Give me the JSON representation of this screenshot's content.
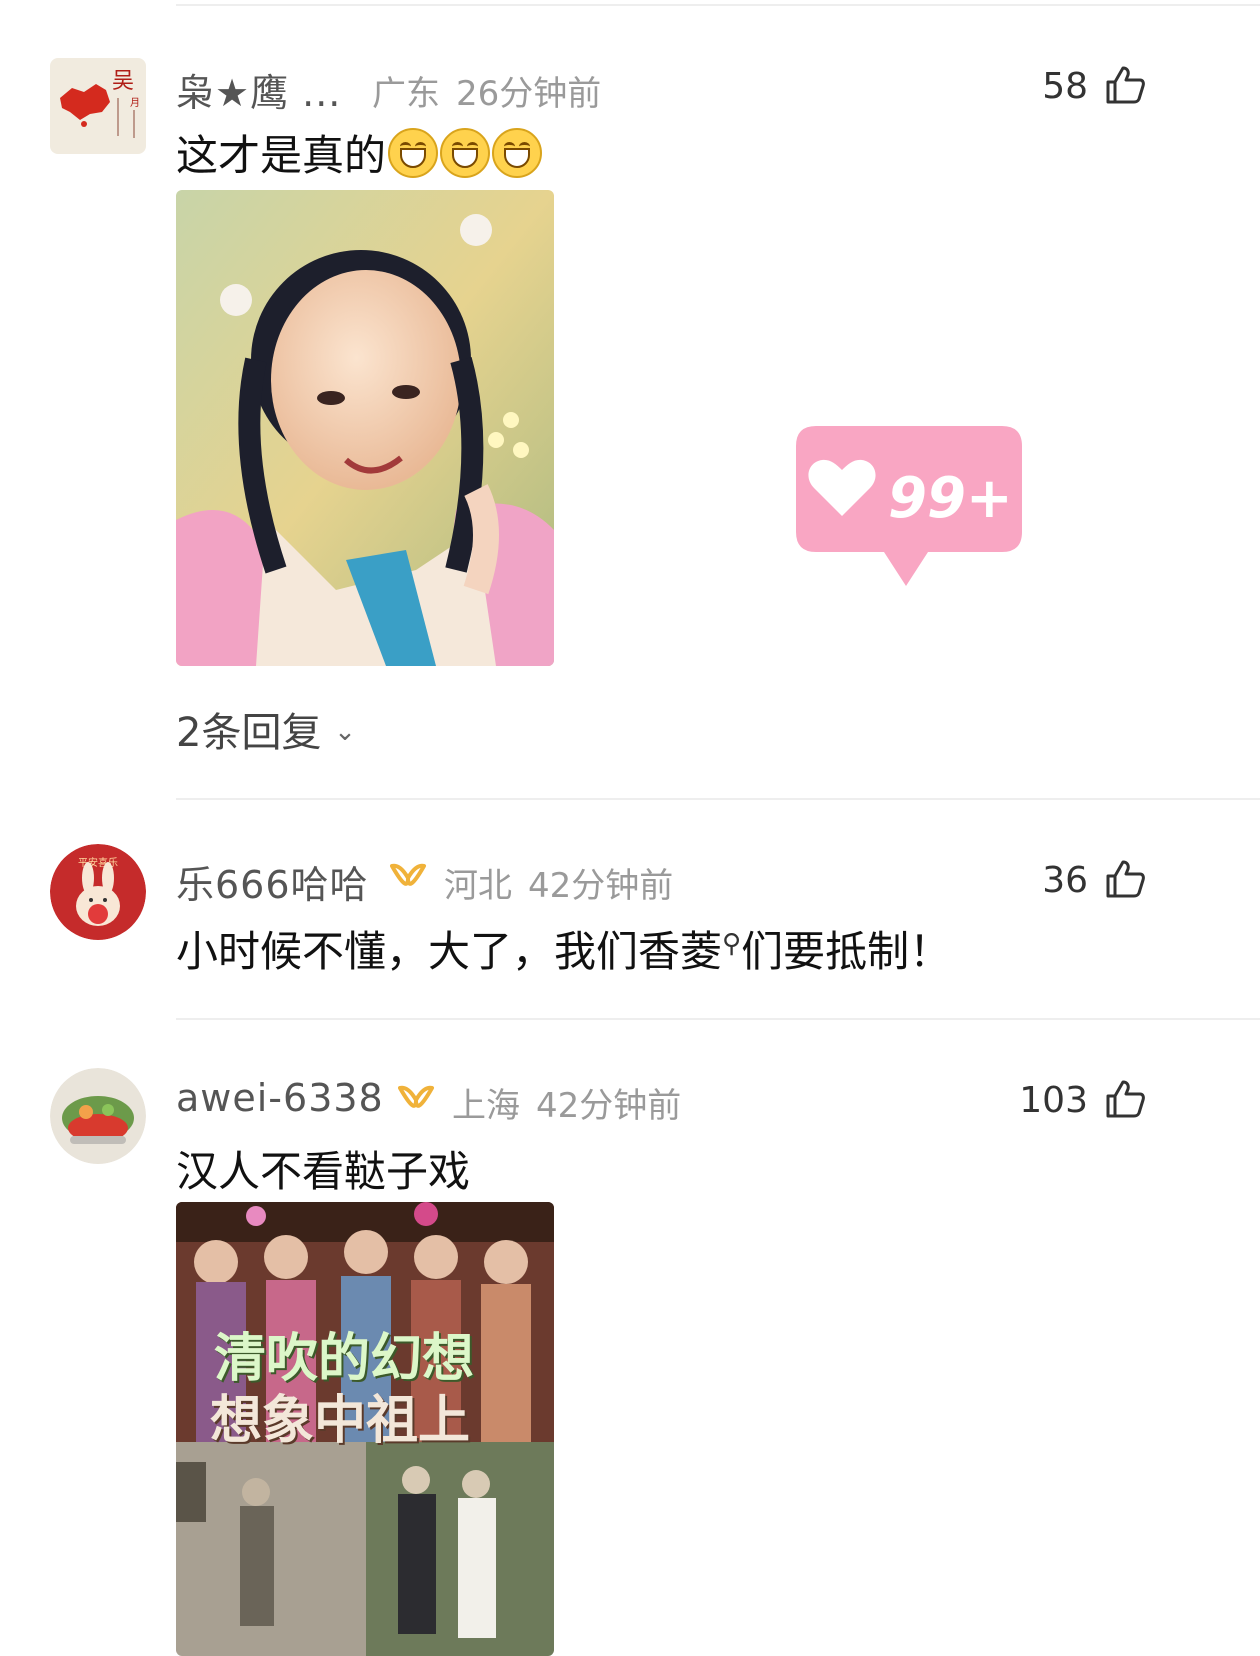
{
  "comments": [
    {
      "username": "枭★鹰 ...",
      "location": "广东",
      "time": "26分钟前",
      "likes": "58",
      "text": "这才是真的",
      "emoji_count": 3,
      "has_image": true,
      "replies": "2条回复"
    },
    {
      "username": "乐666哈哈",
      "location": "河北",
      "time": "42分钟前",
      "likes": "36",
      "text_before": "小时候不懂，大了，我们香菱",
      "text_after": "们要抵制！",
      "has_badge": true
    },
    {
      "username": "awei-6338",
      "location": "上海",
      "time": "42分钟前",
      "likes": "103",
      "text": "汉人不看鞑子戏",
      "has_badge": true,
      "has_image": true,
      "image_caption_line1": "清吹的幻想",
      "image_caption_line2": "想象中祖上"
    }
  ],
  "overlay": {
    "like_bubble_label": "99+",
    "like_bubble_color": "#f9a6c3"
  },
  "colors": {
    "accent_badge": "#f0b23a",
    "meta": "#9a9a9a",
    "divider": "#eeeeee"
  }
}
